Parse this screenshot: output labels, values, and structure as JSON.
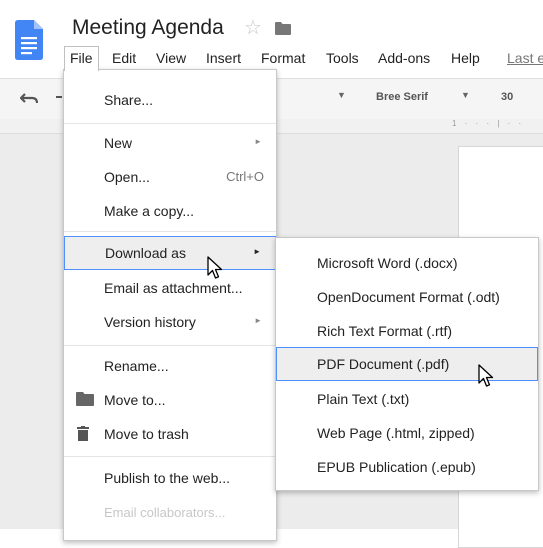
{
  "document": {
    "title": "Meeting Agenda"
  },
  "menubar": {
    "items": [
      "File",
      "Edit",
      "View",
      "Insert",
      "Format",
      "Tools",
      "Add-ons",
      "Help"
    ],
    "last_edit": "Last e"
  },
  "toolbar": {
    "font_name": "Bree Serif",
    "font_size": "30"
  },
  "ruler": {
    "text": "1 · · · | · ·"
  },
  "file_menu": {
    "share": "Share...",
    "new": "New",
    "open": "Open...",
    "open_shortcut": "Ctrl+O",
    "make_copy": "Make a copy...",
    "download_as": "Download as",
    "email_attachment": "Email as attachment...",
    "version_history": "Version history",
    "rename": "Rename...",
    "move_to": "Move to...",
    "move_to_trash": "Move to trash",
    "publish": "Publish to the web...",
    "email_collaborators": "Email collaborators..."
  },
  "download_submenu": {
    "items": [
      "Microsoft Word (.docx)",
      "OpenDocument Format (.odt)",
      "Rich Text Format (.rtf)",
      "PDF Document (.pdf)",
      "Plain Text (.txt)",
      "Web Page (.html, zipped)",
      "EPUB Publication (.epub)"
    ]
  },
  "colors": {
    "docs_blue": "#4285f4",
    "highlight_border": "#4d90fe",
    "highlight_bg": "#eeeeee"
  },
  "icons": [
    "docs-logo-icon",
    "star-icon",
    "folder-icon",
    "undo-icon",
    "redo-icon",
    "chevron-right-icon",
    "folder-move-icon",
    "trash-icon",
    "mouse-cursor-icon"
  ]
}
